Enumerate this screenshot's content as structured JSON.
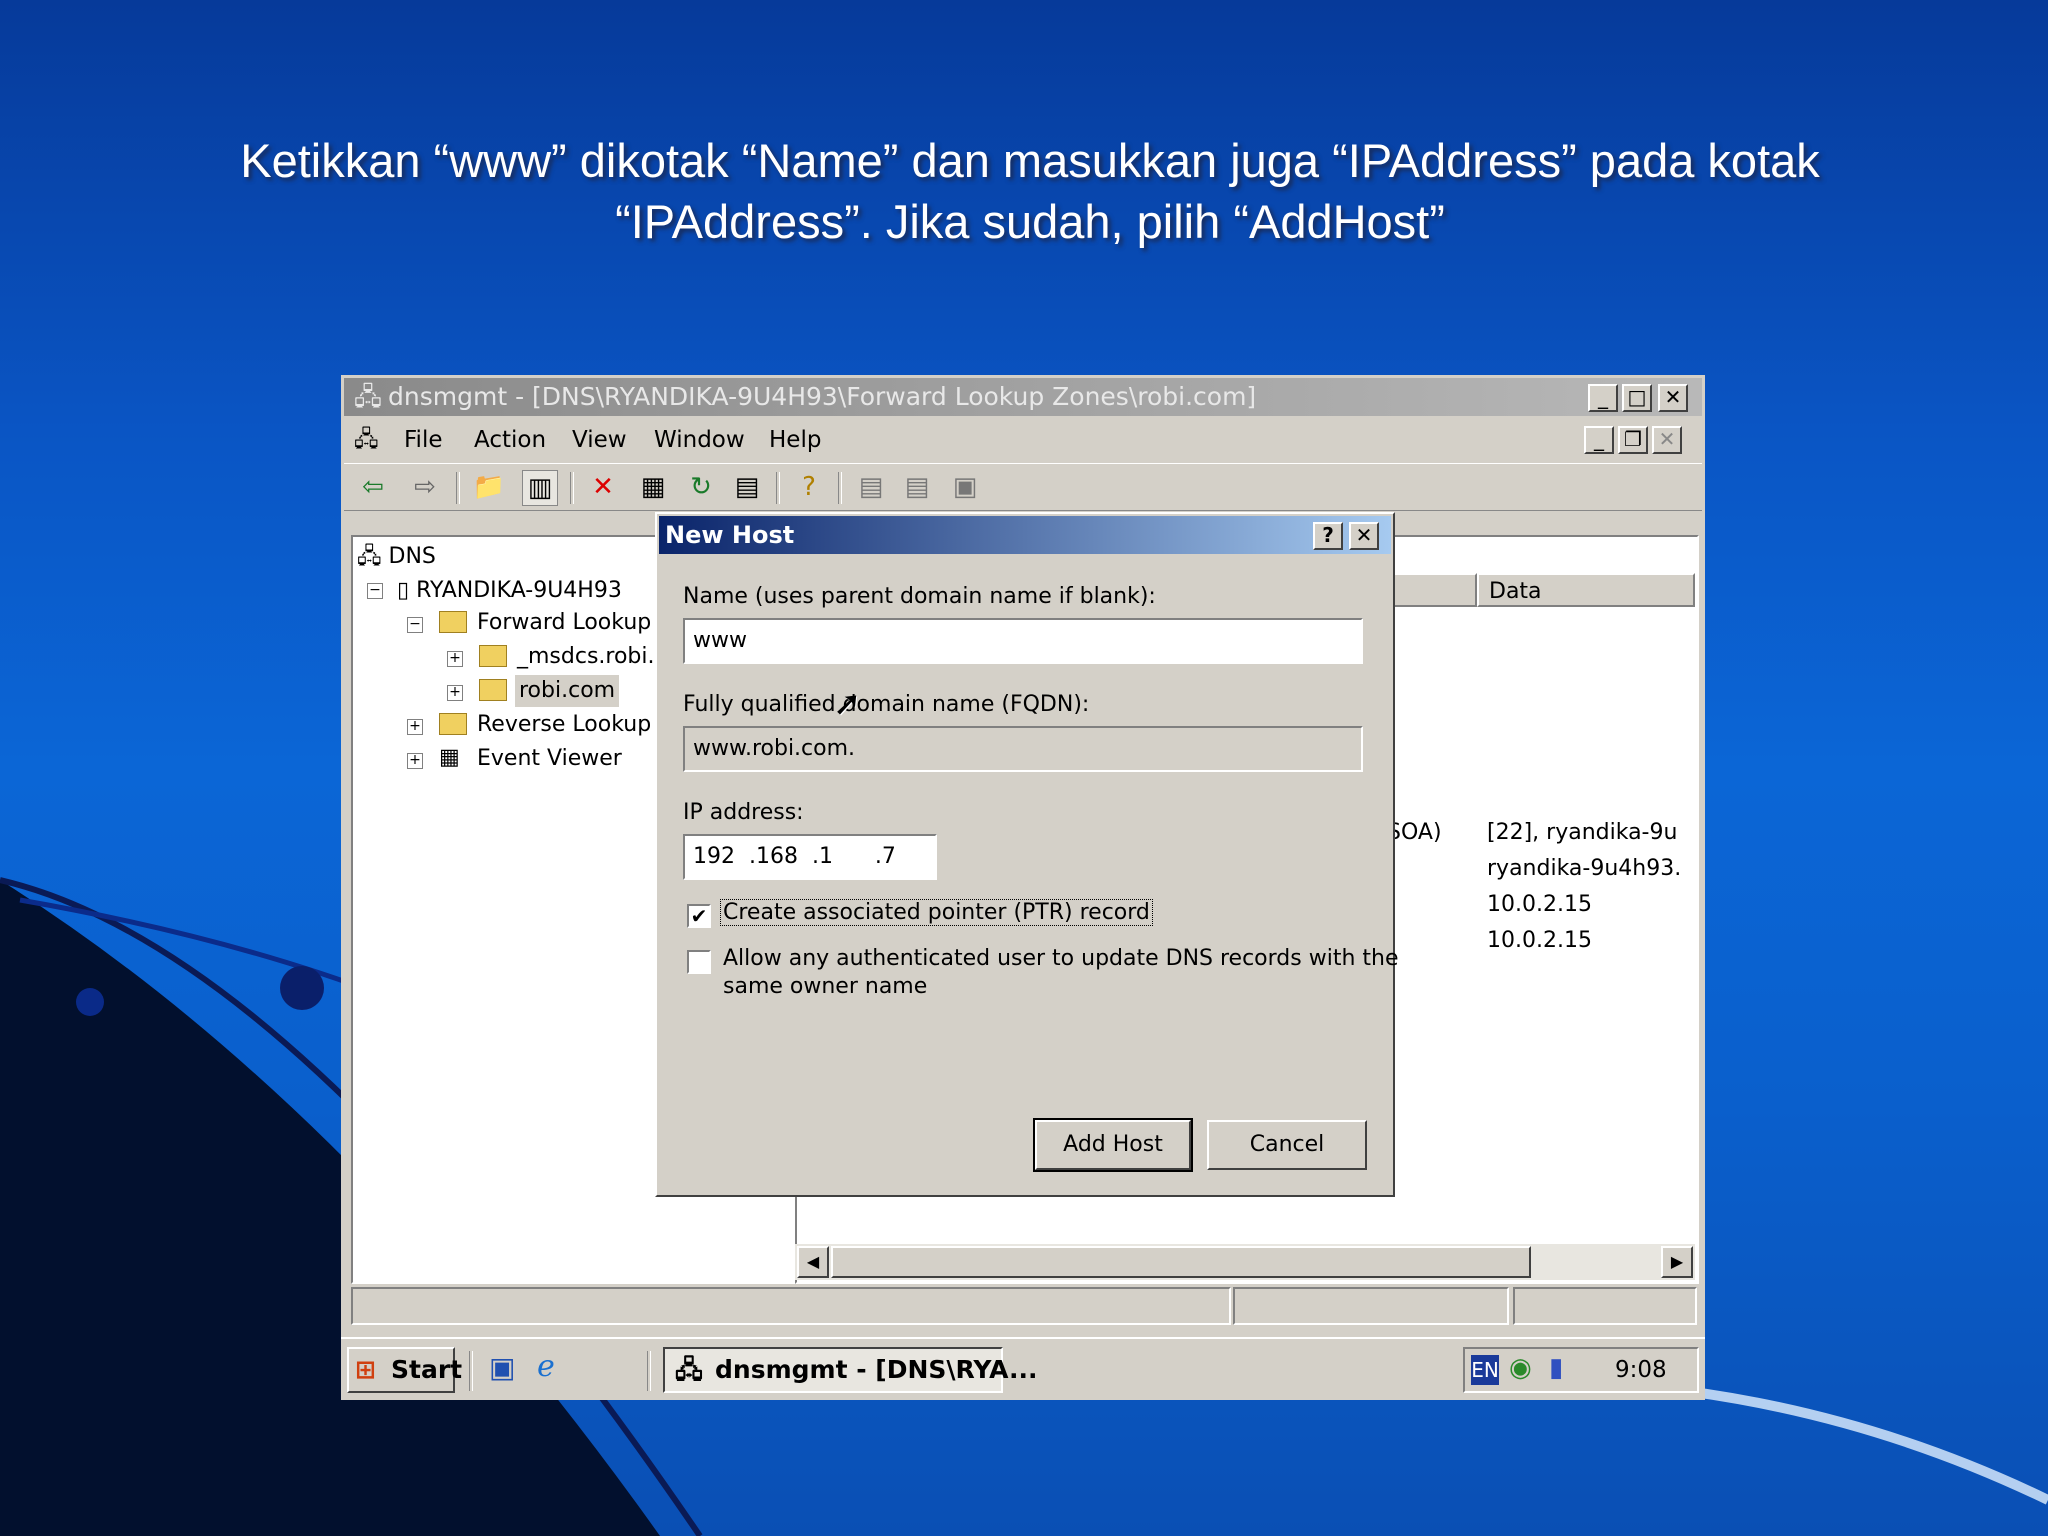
{
  "slide": {
    "caption_line1": "Ketikkan “www” dikotak “Name” dan masukkan juga “IPAddress” pada kotak",
    "caption_line2": "“IPAddress”. Jika sudah, pilih “AddHost”"
  },
  "window": {
    "title": "dnsmgmt - [DNS\\RYANDIKA-9U4H93\\Forward Lookup Zones\\robi.com]",
    "controls": [
      "_",
      "□",
      "✕"
    ]
  },
  "menu": {
    "items": [
      "File",
      "Action",
      "View",
      "Window",
      "Help"
    ]
  },
  "tree": {
    "root": "DNS",
    "server": "RYANDIKA-9U4H93",
    "forward": "Forward Lookup Z",
    "msdcs": "_msdcs.robi.c",
    "zone": "robi.com",
    "reverse": "Reverse Lookup Z",
    "events": "Event Viewer"
  },
  "list": {
    "data_header": "Data",
    "type_soa": "SOA)",
    "rows": [
      "[22], ryandika-9u",
      "ryandika-9u4h93.",
      "10.0.2.15",
      "10.0.2.15"
    ]
  },
  "dialog": {
    "title": "New Host",
    "help": "?",
    "close": "✕",
    "name_label": "Name (uses parent domain name if blank):",
    "name_value": "www",
    "fqdn_label": "Fully qualified domain name (FQDN):",
    "fqdn_value": "www.robi.com.",
    "ip_label": "IP address:",
    "ip_value": "192  .168  .1      .7",
    "ptr_label": "Create associated pointer (PTR) record",
    "ptr_checked": true,
    "allow_label_1": "Allow any authenticated user to update DNS records with the",
    "allow_label_2": "same owner name",
    "allow_checked": false,
    "add_button": "Add Host",
    "cancel_button": "Cancel"
  },
  "taskbar": {
    "start": "Start",
    "task": "dnsmgmt - [DNS\\RYA...",
    "lang": "EN",
    "clock": "9:08"
  }
}
